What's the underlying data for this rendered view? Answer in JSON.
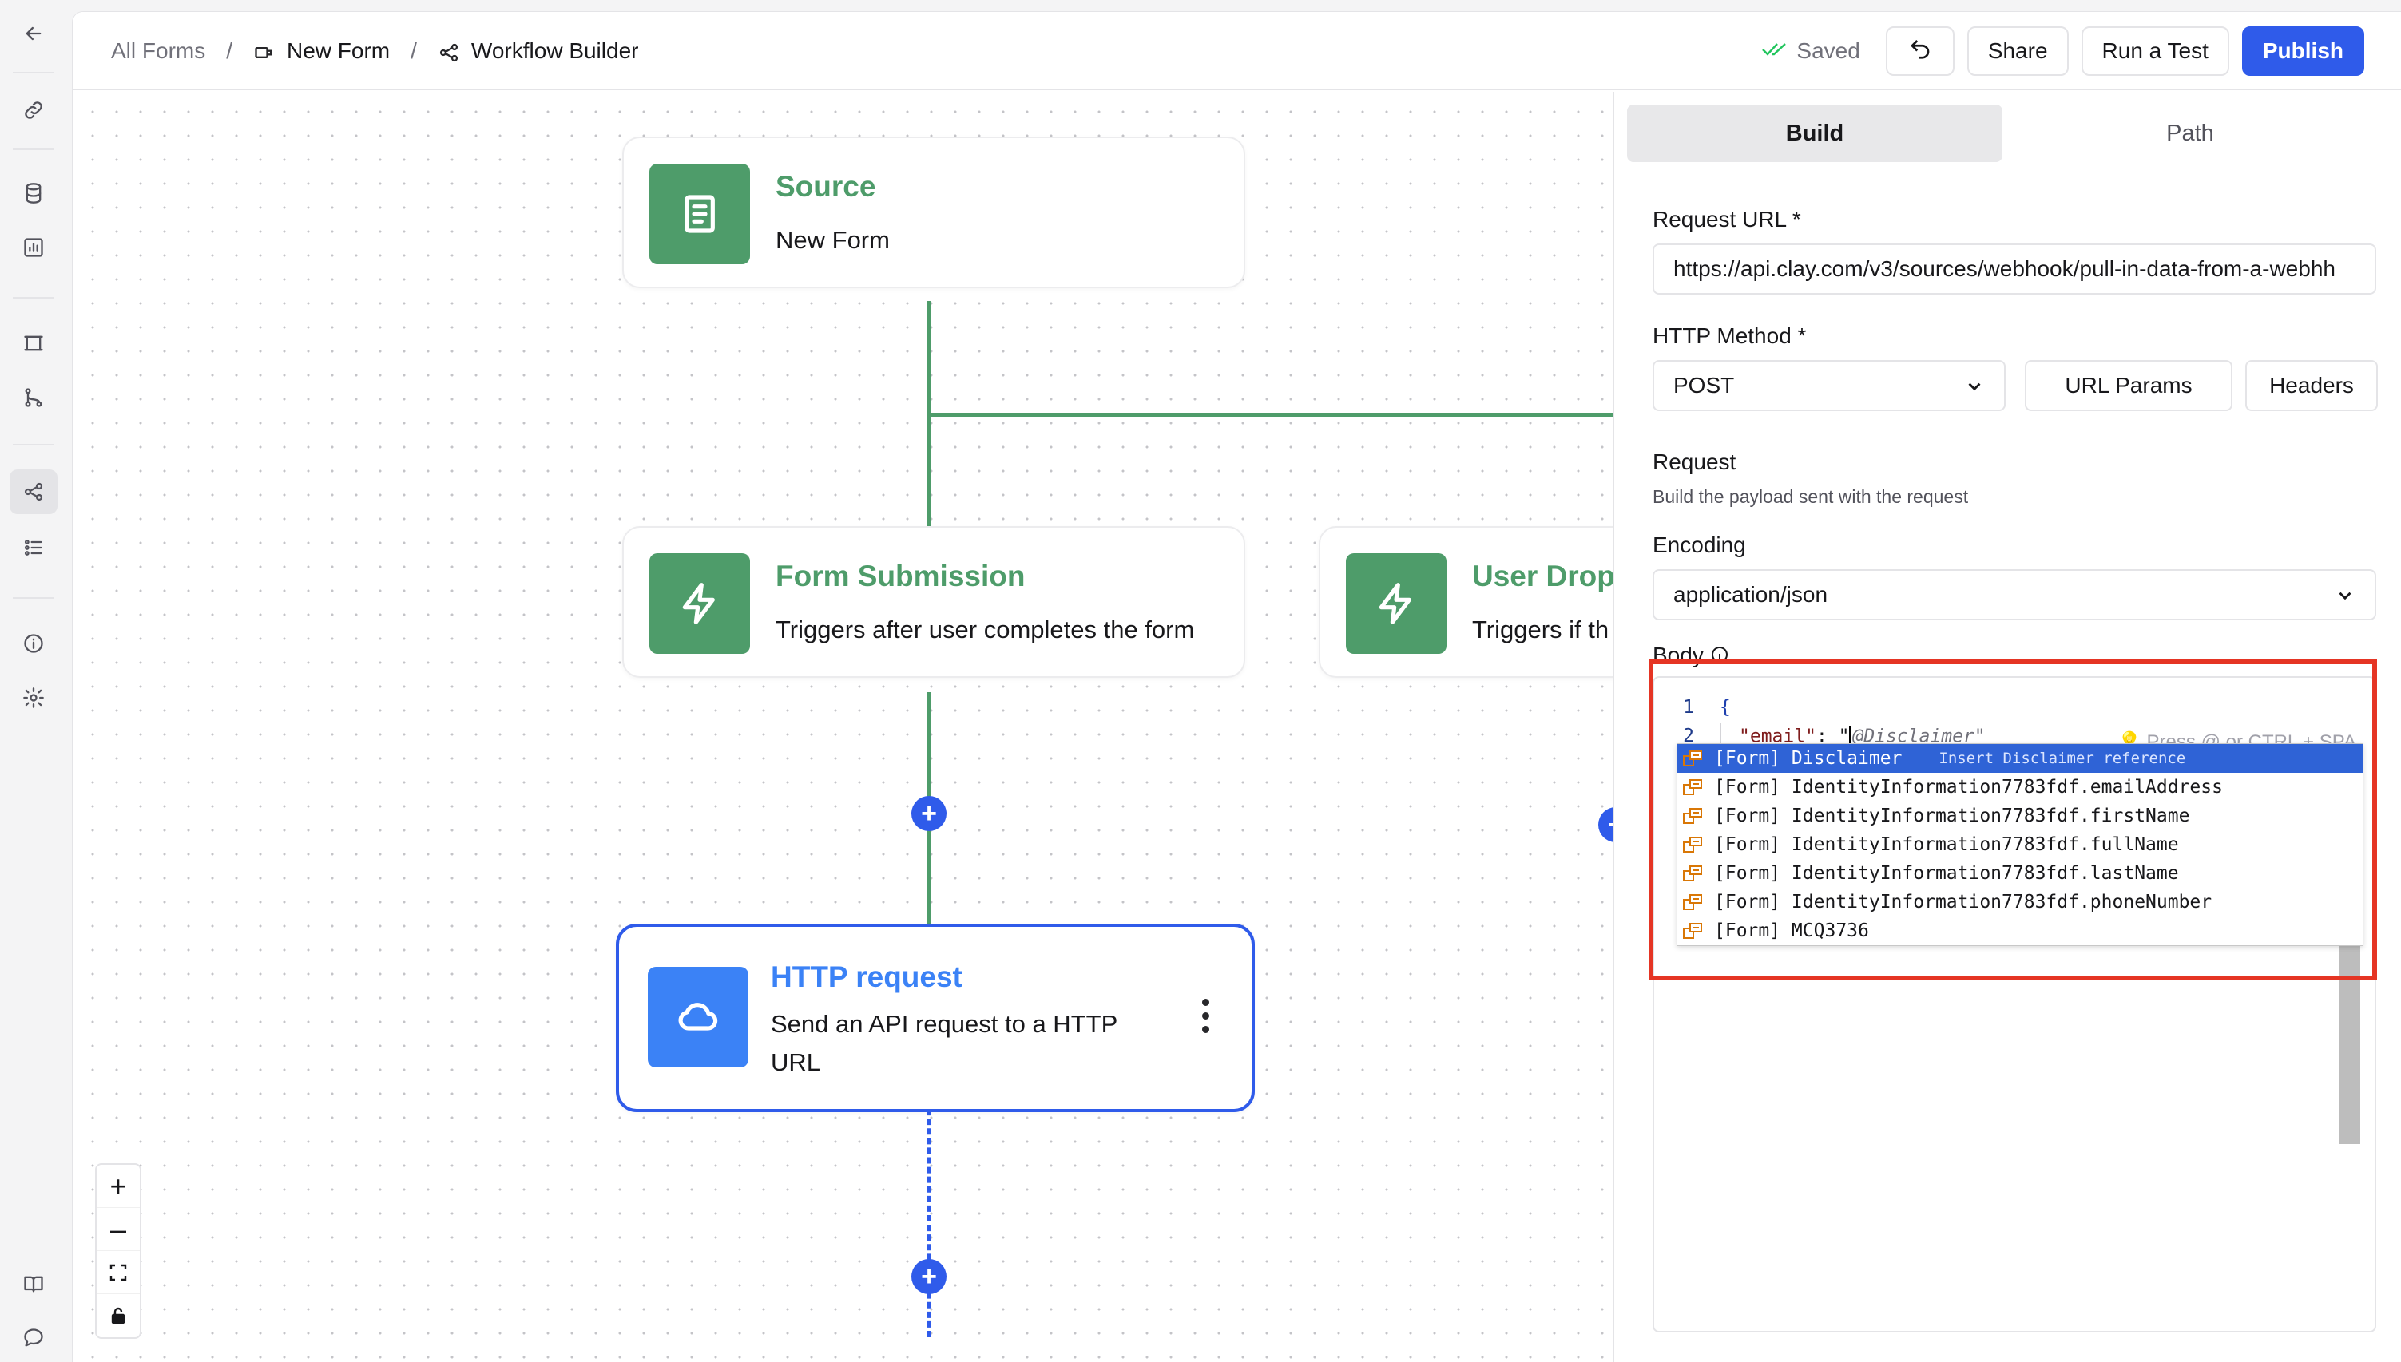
{
  "breadcrumb": {
    "root": "All Forms",
    "form": "New Form",
    "current": "Workflow Builder",
    "separator": "/"
  },
  "header": {
    "saved_label": "Saved",
    "share_label": "Share",
    "run_test_label": "Run a Test",
    "publish_label": "Publish"
  },
  "rail_icons": [
    "back-arrow-icon",
    "link-icon",
    "database-icon",
    "chart-icon",
    "frame-icon",
    "branch-icon",
    "workflow-icon",
    "checklist-icon",
    "info-icon",
    "settings-icon",
    "book-icon",
    "chat-icon"
  ],
  "nodes": {
    "source": {
      "title": "Source",
      "subtitle": "New Form"
    },
    "form_submission": {
      "title": "Form Submission",
      "subtitle": "Triggers after user completes the form"
    },
    "user_drop": {
      "title": "User Dropp",
      "subtitle": "Triggers if th"
    },
    "http_request": {
      "title": "HTTP request",
      "subtitle": "Send an API request to a HTTP URL"
    }
  },
  "zoom_controls": {
    "zoom_in": "+",
    "zoom_out": "–"
  },
  "panel": {
    "tabs": {
      "build": "Build",
      "path": "Path"
    },
    "request_url_label": "Request URL *",
    "request_url_value": "https://api.clay.com/v3/sources/webhook/pull-in-data-from-a-webhh",
    "http_method_label": "HTTP Method *",
    "http_method_value": "POST",
    "url_params_label": "URL Params",
    "headers_label": "Headers",
    "request_label": "Request",
    "request_hint": "Build the payload sent with the request",
    "encoding_label": "Encoding",
    "encoding_value": "application/json",
    "body_label": "Body"
  },
  "editor": {
    "line1_no": "1",
    "line2_no": "2",
    "line1": "{",
    "line2_key": "\"email\"",
    "line2_colon": ": \"",
    "line2_placeholder": "@Disclaimer\"",
    "tip": "💡 Press @ or CTRL + SPA",
    "autocomplete": [
      {
        "label": "[Form] Disclaimer",
        "desc": "Insert Disclaimer reference",
        "selected": true
      },
      {
        "label": "[Form] IdentityInformation7783fdf.emailAddress"
      },
      {
        "label": "[Form] IdentityInformation7783fdf.firstName"
      },
      {
        "label": "[Form] IdentityInformation7783fdf.fullName"
      },
      {
        "label": "[Form] IdentityInformation7783fdf.lastName"
      },
      {
        "label": "[Form] IdentityInformation7783fdf.phoneNumber"
      },
      {
        "label": "[Form] MCQ3736"
      }
    ]
  },
  "colors": {
    "accent": "#2f5bea",
    "node_green": "#4e9c6a",
    "http_blue": "#3b82f6",
    "highlight_red": "#e53524",
    "selection": "#2f63d6"
  }
}
